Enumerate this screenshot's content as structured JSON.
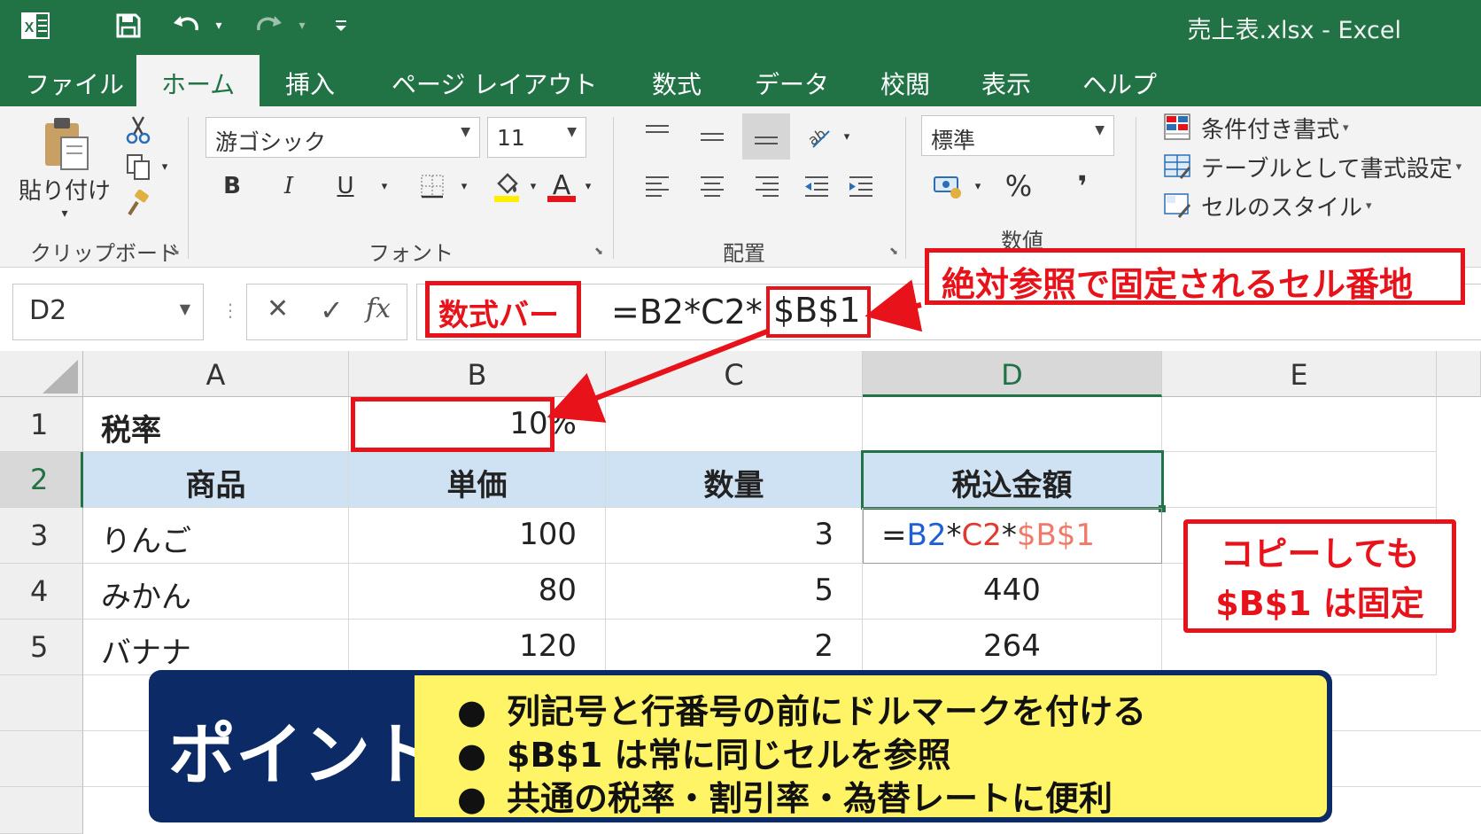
{
  "titlebar": {
    "title": "売上表.xlsx  -  Excel",
    "icons": [
      "excel-logo-icon",
      "save-icon",
      "undo-icon",
      "redo-icon",
      "customize-qat-icon"
    ]
  },
  "tabs": [
    {
      "label": "ファイル"
    },
    {
      "label": "ホーム",
      "active": true
    },
    {
      "label": "挿入"
    },
    {
      "label": "ページ レイアウト"
    },
    {
      "label": "数式"
    },
    {
      "label": "データ"
    },
    {
      "label": "校閲"
    },
    {
      "label": "表示"
    },
    {
      "label": "ヘルプ"
    }
  ],
  "ribbon": {
    "clipboard": {
      "paste_label": "貼り付け",
      "group_label": "クリップボード"
    },
    "font": {
      "font_name": "游ゴシック",
      "font_size": "11",
      "bold": "B",
      "italic": "I",
      "underline": "U",
      "font_color_letter": "A",
      "group_label": "フォント"
    },
    "alignment": {
      "group_label": "配置"
    },
    "number": {
      "format": "標準",
      "percent": "%",
      "comma": "❜",
      "group_label": "数値"
    },
    "styles": {
      "conditional": "条件付き書式",
      "as_table": "テーブルとして書式設定",
      "cell_styles": "セルのスタイル"
    }
  },
  "formula_bar": {
    "name_box": "D2",
    "fx": "fx",
    "cancel": "✕",
    "enter": "✓",
    "formula_prefix": "=B2*C2*",
    "formula_highlight": "$B$1"
  },
  "callouts": {
    "formula_bar_label": "数式バー",
    "absolute_ref_label": "絶対参照で固定されるセル番地",
    "copy_note_line1": "コピーしても",
    "copy_note_line2": "$B$1 は固定"
  },
  "sheet": {
    "columns": [
      "A",
      "B",
      "C",
      "D",
      "E"
    ],
    "rows": [
      "1",
      "2",
      "3",
      "4",
      "5"
    ],
    "r1": {
      "a": "税率",
      "b": "10%"
    },
    "header": {
      "a": "商品",
      "b": "単価",
      "c": "数量",
      "d": "税込金額"
    },
    "data": [
      {
        "a": "りんご",
        "b": "100",
        "c": "3"
      },
      {
        "a": "みかん",
        "b": "80",
        "c": "5",
        "d": "440"
      },
      {
        "a": "バナナ",
        "b": "120",
        "c": "2",
        "d": "264"
      }
    ],
    "d3_formula": {
      "eq": "=",
      "ref1": "B2",
      "op1": "*",
      "ref2": "C2",
      "op2": "*",
      "ref3": "$B$1"
    },
    "colors": {
      "ref1": "#1f5fd6",
      "ref2": "#e03a2f",
      "ref3": "#f07a6a",
      "header_fill": "#cfe2f3",
      "accent": "#217346"
    }
  },
  "point": {
    "title": "ポイント",
    "items": [
      "列記号と行番号の前にドルマークを付ける",
      "$B$1 は常に同じセルを参照",
      "共通の税率・割引率・為替レートに便利"
    ],
    "bullet": "●"
  }
}
